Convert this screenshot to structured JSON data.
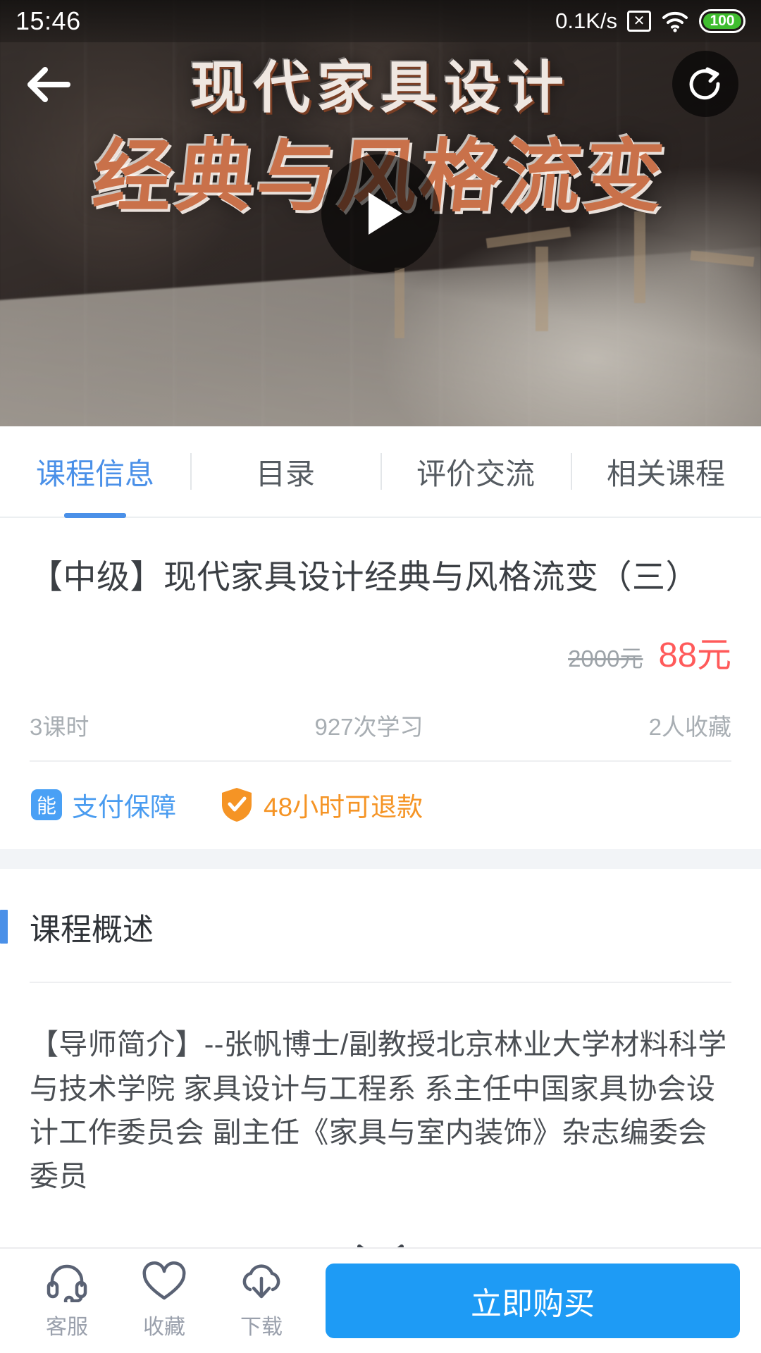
{
  "statusbar": {
    "time": "15:46",
    "network_speed": "0.1K/s",
    "sim_icon": "sim-off-icon",
    "wifi_icon": "wifi-icon",
    "battery_level": "100"
  },
  "hero": {
    "title_line1": "现代家具设计",
    "title_line2": "经典与风格流变",
    "back_icon": "back-arrow-icon",
    "share_icon": "share-refresh-icon",
    "play_icon": "play-icon"
  },
  "tabs": [
    {
      "label": "课程信息",
      "active": true
    },
    {
      "label": "目录",
      "active": false
    },
    {
      "label": "评价交流",
      "active": false
    },
    {
      "label": "相关课程",
      "active": false
    }
  ],
  "course": {
    "title": "【中级】现代家具设计经典与风格流变（三）",
    "price_original": "2000元",
    "price_current": "88元",
    "lessons": "3课时",
    "study_count": "927次学习",
    "favorite_count": "2人收藏",
    "assurance_pay_badge": "能",
    "assurance_pay_label": "支付保障",
    "assurance_refund_label": "48小时可退款",
    "refund_shield_icon": "shield-check-icon"
  },
  "overview": {
    "section_title": "课程概述",
    "description": "【导师简介】--张帆博士/副教授北京林业大学材料科学与技术学院 家具设计与工程系 系主任中国家具协会设计工作委员会 副主任《家具与室内装饰》杂志编委会委员",
    "expand_icon": "chevron-down-icon"
  },
  "bottombar": {
    "items": [
      {
        "label": "客服",
        "icon": "headset-icon"
      },
      {
        "label": "收藏",
        "icon": "heart-icon"
      },
      {
        "label": "下载",
        "icon": "cloud-download-icon"
      }
    ],
    "buy_label": "立即购买"
  },
  "colors": {
    "accent_blue": "#4a90e8",
    "buy_blue": "#1e9bf5",
    "price_red": "#ff5a5a",
    "refund_orange": "#f59425",
    "meta_gray": "#a8aeb3",
    "band_gray": "#f2f4f7"
  }
}
